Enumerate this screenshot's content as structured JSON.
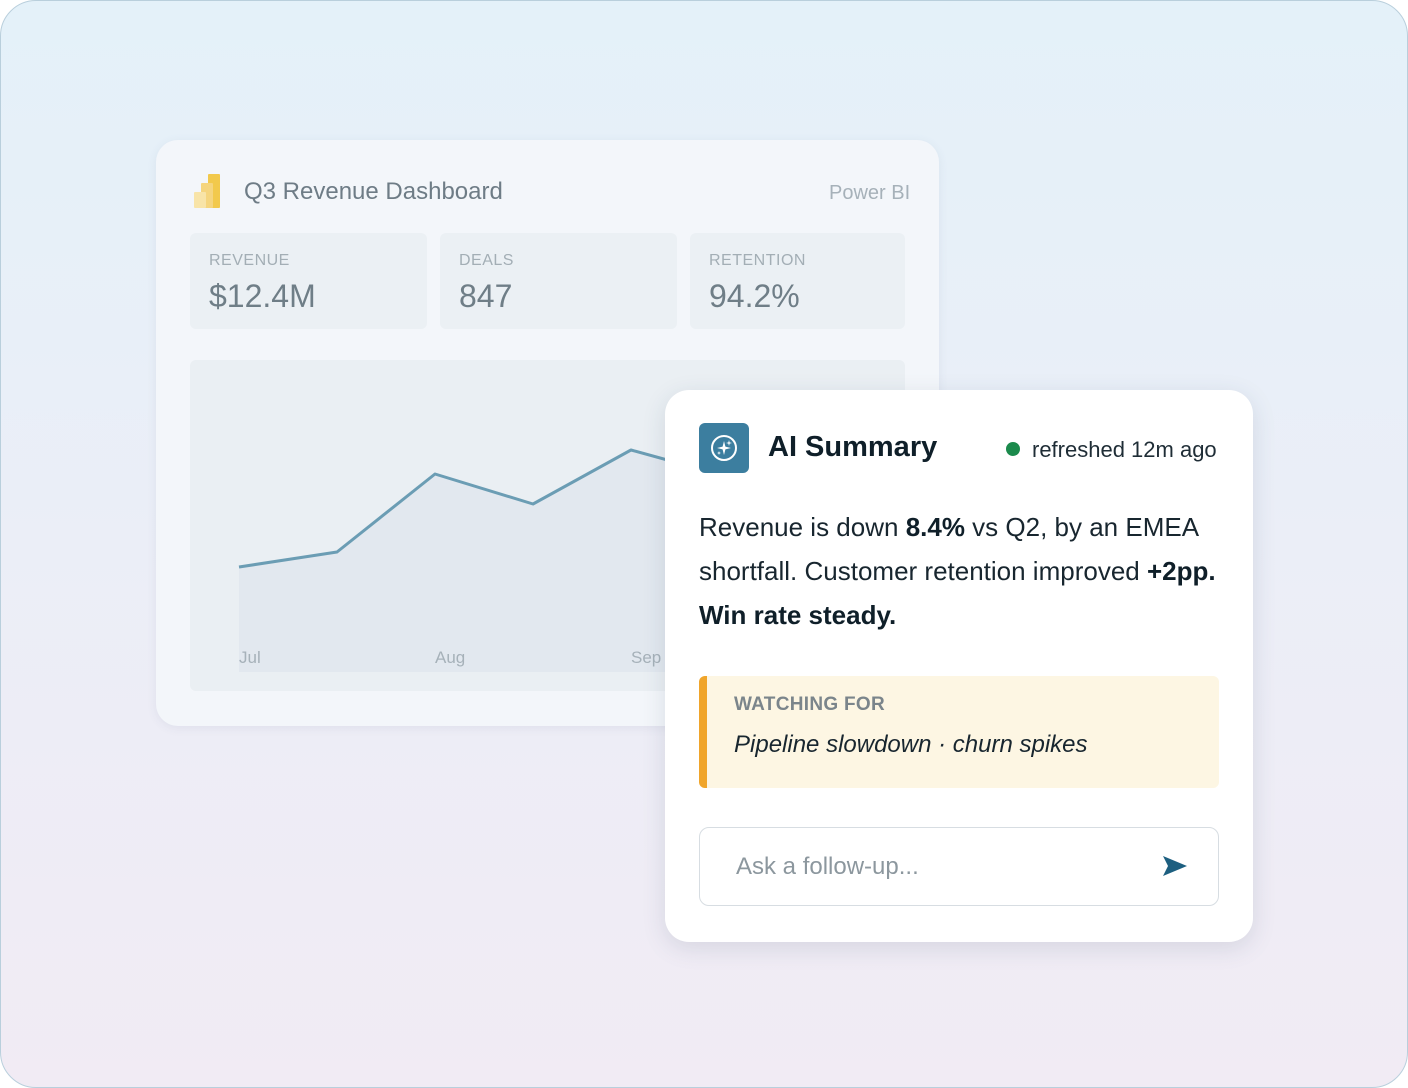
{
  "dashboard": {
    "title": "Q3 Revenue Dashboard",
    "source": "Power BI",
    "logo_icon": "power-bi-logo-icon",
    "kpis": [
      {
        "label": "REVENUE",
        "value": "$12.4M"
      },
      {
        "label": "DEALS",
        "value": "847"
      },
      {
        "label": "RETENTION",
        "value": "94.2%"
      }
    ]
  },
  "chart_data": {
    "type": "area",
    "x": [
      "Jul",
      "",
      "Aug",
      "",
      "Sep",
      ""
    ],
    "tick_labels": [
      "Jul",
      "Aug",
      "Sep"
    ],
    "values": [
      35,
      40,
      66,
      56,
      74,
      65
    ],
    "ylim": [
      0,
      100
    ],
    "grid": false,
    "line_color": "#6b9db4",
    "fill_color": "#e2e8ef"
  },
  "ai_summary": {
    "icon": "sparkle-icon",
    "title": "AI Summary",
    "status": "refreshed 12m ago",
    "status_color": "#1b8a4c",
    "summary_parts": {
      "p1": "Revenue is down ",
      "b1": "8.4%",
      "p2": " vs Q2, by an EMEA shortfall. Customer retention improved ",
      "b2": "+2pp. Win rate steady."
    },
    "watching_label": "WATCHING FOR",
    "watching_text": "Pipeline slowdown · churn spikes",
    "followup_placeholder": "Ask a follow-up...",
    "send_icon": "send-icon",
    "accent": "#3c7e9f"
  }
}
